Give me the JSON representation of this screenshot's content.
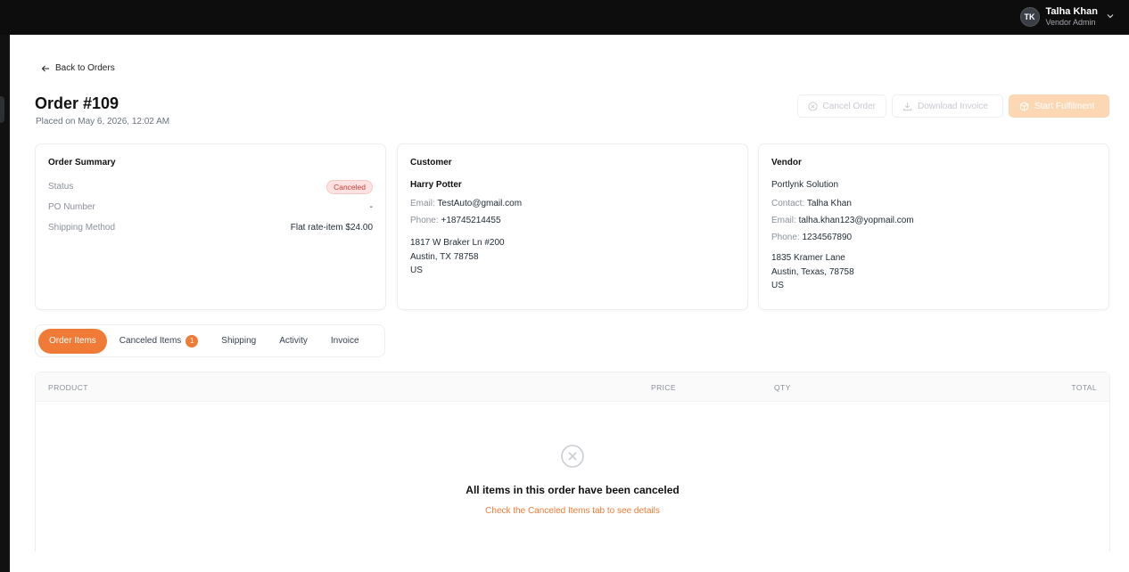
{
  "header": {
    "user": {
      "initials": "TK",
      "name": "Talha Khan",
      "role": "Vendor Admin"
    }
  },
  "back_label": "Back to Orders",
  "order": {
    "title": "Order #109",
    "placed": "Placed on May 6, 2026, 12:02 AM"
  },
  "actions": {
    "cancel": "Cancel Order",
    "download": "Download Invoice",
    "start": "Start Fulfilment"
  },
  "summary": {
    "heading": "Order Summary",
    "status_label": "Status",
    "status_value": "Canceled",
    "po_label": "PO Number",
    "po_value": "-",
    "shipping_label": "Shipping Method",
    "shipping_value": "Flat rate-item $24.00"
  },
  "customer": {
    "heading": "Customer",
    "name": "Harry Potter",
    "email_label": "Email:",
    "email": "TestAuto@gmail.com",
    "phone_label": "Phone:",
    "phone": "+18745214455",
    "address": [
      "1817 W Braker Ln #200",
      "Austin, TX 78758",
      "US"
    ]
  },
  "vendor": {
    "heading": "Vendor",
    "company": "Portlynk Solution",
    "contact_label": "Contact:",
    "contact": "Talha Khan",
    "email_label": "Email:",
    "email": "talha.khan123@yopmail.com",
    "phone_label": "Phone:",
    "phone": "1234567890",
    "address": [
      "1835 Kramer Lane",
      "Austin, Texas, 78758",
      "US"
    ]
  },
  "tabs": [
    {
      "label": "Order Items",
      "active": true
    },
    {
      "label": "Canceled Items",
      "count": "1"
    },
    {
      "label": "Shipping"
    },
    {
      "label": "Activity"
    },
    {
      "label": "Invoice"
    }
  ],
  "table": {
    "columns": [
      "PRODUCT",
      "PRICE",
      "QTY",
      "TOTAL"
    ],
    "empty_title": "All items in this order have been canceled",
    "empty_sub": "Check the Canceled Items tab to see details"
  },
  "colors": {
    "accent": "#f07b36",
    "accent_disabled": "#fbd7b4",
    "badge_bg": "#fde2e1",
    "badge_text": "#d23b35"
  }
}
